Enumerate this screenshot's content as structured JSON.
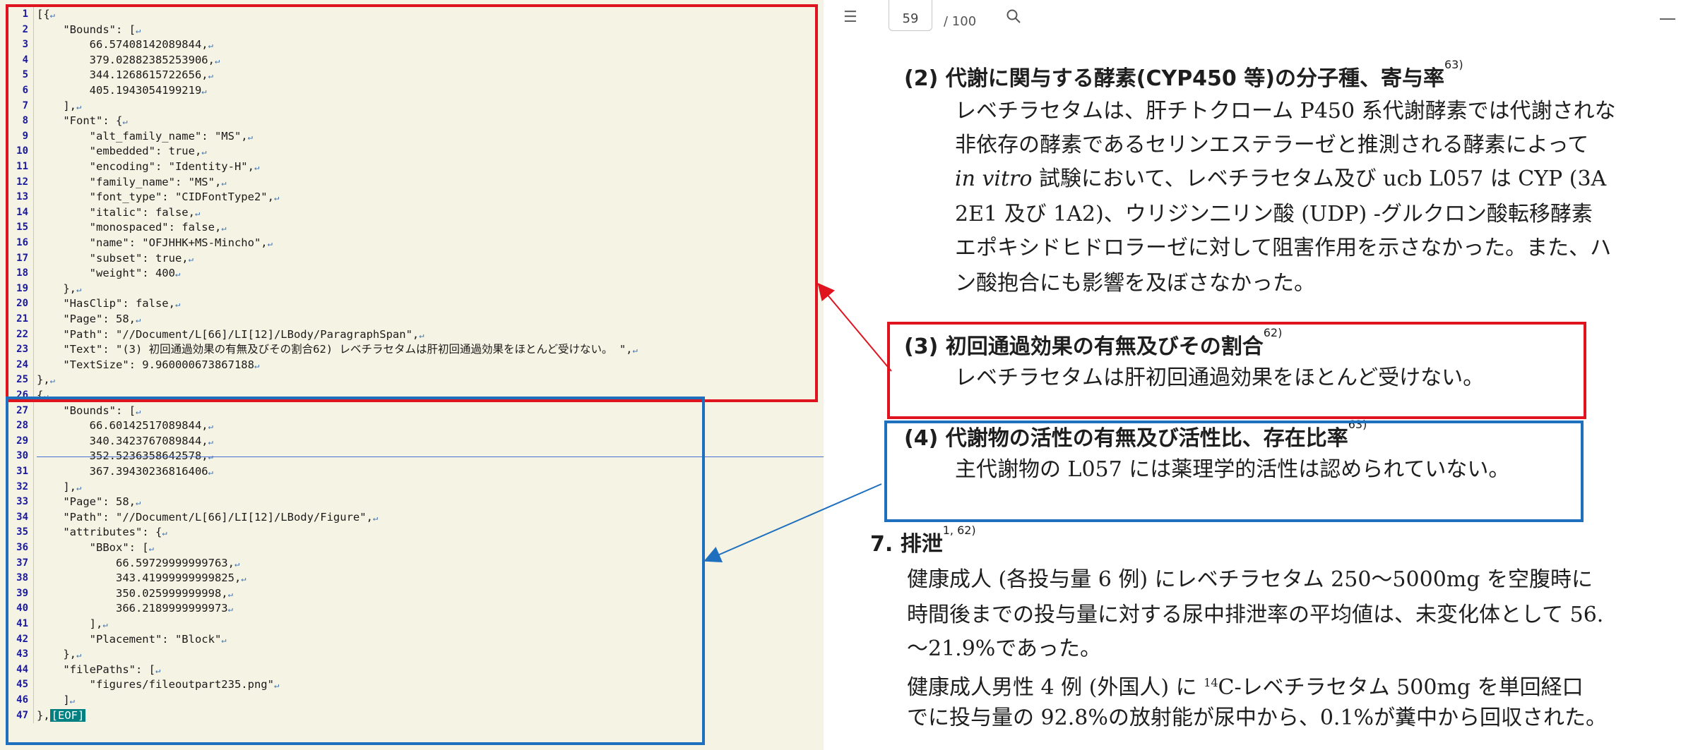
{
  "editor": {
    "lines": [
      {
        "n": "1",
        "t": "[{"
      },
      {
        "n": "2",
        "t": "    \"Bounds\": ["
      },
      {
        "n": "3",
        "t": "        66.57408142089844,"
      },
      {
        "n": "4",
        "t": "        379.02882385253906,"
      },
      {
        "n": "5",
        "t": "        344.1268615722656,"
      },
      {
        "n": "6",
        "t": "        405.1943054199219"
      },
      {
        "n": "7",
        "t": "    ],"
      },
      {
        "n": "8",
        "t": "    \"Font\": {"
      },
      {
        "n": "9",
        "t": "        \"alt_family_name\": \"MS\","
      },
      {
        "n": "10",
        "t": "        \"embedded\": true,"
      },
      {
        "n": "11",
        "t": "        \"encoding\": \"Identity-H\","
      },
      {
        "n": "12",
        "t": "        \"family_name\": \"MS\","
      },
      {
        "n": "13",
        "t": "        \"font_type\": \"CIDFontType2\","
      },
      {
        "n": "14",
        "t": "        \"italic\": false,"
      },
      {
        "n": "15",
        "t": "        \"monospaced\": false,"
      },
      {
        "n": "16",
        "t": "        \"name\": \"OFJHHK+MS-Mincho\","
      },
      {
        "n": "17",
        "t": "        \"subset\": true,"
      },
      {
        "n": "18",
        "t": "        \"weight\": 400"
      },
      {
        "n": "19",
        "t": "    },"
      },
      {
        "n": "20",
        "t": "    \"HasClip\": false,"
      },
      {
        "n": "21",
        "t": "    \"Page\": 58,"
      },
      {
        "n": "22",
        "t": "    \"Path\": \"//Document/L[66]/LI[12]/LBody/ParagraphSpan\","
      },
      {
        "n": "23",
        "t": "    \"Text\": \"(3) 初回通過効果の有無及びその割合62) レベチラセタムは肝初回通過効果をほとんど受けない。 \","
      },
      {
        "n": "24",
        "t": "    \"TextSize\": 9.960000673867188"
      },
      {
        "n": "25",
        "t": "},"
      },
      {
        "n": "26",
        "t": "{"
      },
      {
        "n": "27",
        "t": "    \"Bounds\": ["
      },
      {
        "n": "28",
        "t": "        66.60142517089844,"
      },
      {
        "n": "29",
        "t": "        340.3423767089844,"
      },
      {
        "n": "30",
        "t": "        352.5236358642578,"
      },
      {
        "n": "31",
        "t": "        367.39430236816406"
      },
      {
        "n": "32",
        "t": "    ],"
      },
      {
        "n": "33",
        "t": "    \"Page\": 58,"
      },
      {
        "n": "34",
        "t": "    \"Path\": \"//Document/L[66]/LI[12]/LBody/Figure\","
      },
      {
        "n": "35",
        "t": "    \"attributes\": {"
      },
      {
        "n": "36",
        "t": "        \"BBox\": ["
      },
      {
        "n": "37",
        "t": "            66.59729999999763,"
      },
      {
        "n": "38",
        "t": "            343.41999999999825,"
      },
      {
        "n": "39",
        "t": "            350.025999999998,"
      },
      {
        "n": "40",
        "t": "            366.2189999999973"
      },
      {
        "n": "41",
        "t": "        ],"
      },
      {
        "n": "42",
        "t": "        \"Placement\": \"Block\""
      },
      {
        "n": "43",
        "t": "    },"
      },
      {
        "n": "44",
        "t": "    \"filePaths\": ["
      },
      {
        "n": "45",
        "t": "        \"figures/fileoutpart235.png\""
      },
      {
        "n": "46",
        "t": "    ]"
      },
      {
        "n": "47",
        "t": "},"
      }
    ],
    "eof_label": "[EOF]"
  },
  "viewer": {
    "page_current": "59",
    "page_total": "/ 100",
    "icons": [
      "list-icon",
      "search-icon",
      "minus-icon"
    ]
  },
  "doc": {
    "h2": {
      "text": "(2) 代謝に関与する酵素(CYP450 等)の分子種、寄与率",
      "sup": "63)"
    },
    "p2": [
      "レベチラセタムは、肝チトクローム P450 系代謝酵素では代謝されな",
      "非依存の酵素であるセリンエステラーゼと推測される酵素によって",
      "試験において、レベチラセタム及び ucb L057 は CYP (3A",
      "2E1 及び 1A2)、ウリジン二リン酸 (UDP) -グルクロン酸転移酵素",
      "エポキシドヒドロラーゼに対して阻害作用を示さなかった。また、ハ",
      "ン酸抱合にも影響を及ぼさなかった。"
    ],
    "p2_italic": "in vitro",
    "h3": {
      "text": "(3) 初回通過効果の有無及びその割合",
      "sup": "62)"
    },
    "p3": "レベチラセタムは肝初回通過効果をほとんど受けない。",
    "h4": {
      "text": "(4) 代謝物の活性の有無及び活性比、存在比率",
      "sup": "63)"
    },
    "p4": "主代謝物の L057 には薬理学的活性は認められていない。",
    "h7": {
      "text": "7.  排泄",
      "sup": "1, 62)"
    },
    "p7": [
      "健康成人 (各投与量 6 例) にレベチラセタム 250〜5000mg を空腹時に",
      "時間後までの投与量に対する尿中排泄率の平均値は、未変化体として 56.",
      "〜21.9%であった。",
      "健康成人男性 4 例 (外国人) に ",
      "でに投与量の 92.8%の放射能が尿中から、0.1%が糞中から回収された。"
    ],
    "p7_line4_sup": "14",
    "p7_line4_rest": "C-レベチラセタム 500mg を単回経口"
  },
  "colors": {
    "red": "#e0141e",
    "blue": "#1f6fbf"
  }
}
